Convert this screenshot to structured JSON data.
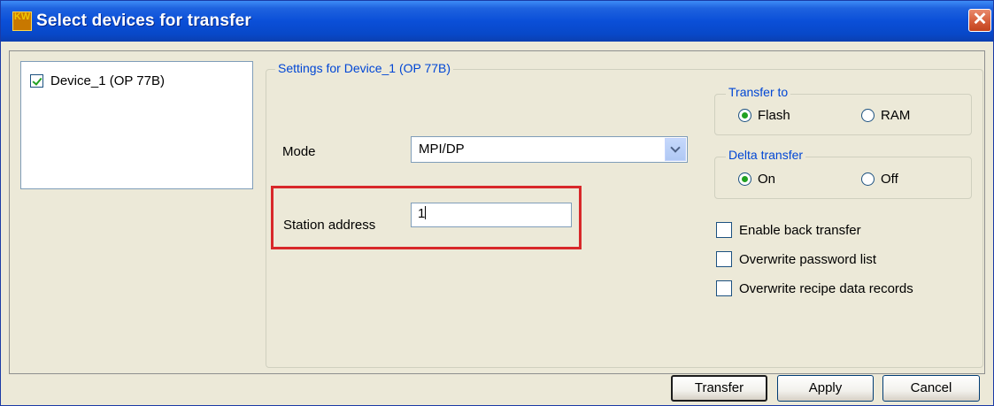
{
  "window": {
    "title": "Select devices for transfer",
    "icon_text": "KW"
  },
  "device_list": {
    "items": [
      {
        "label": "Device_1 (OP 77B)",
        "checked": true
      }
    ]
  },
  "settings": {
    "group_title": "Settings for Device_1 (OP 77B)",
    "mode_label": "Mode",
    "mode_value": "MPI/DP",
    "station_label": "Station address",
    "station_value": "1"
  },
  "transfer_to": {
    "title": "Transfer to",
    "options": [
      "Flash",
      "RAM"
    ],
    "selected": "Flash"
  },
  "delta_transfer": {
    "title": "Delta transfer",
    "options": [
      "On",
      "Off"
    ],
    "selected": "On"
  },
  "checkboxes": [
    {
      "label": "Enable back transfer",
      "checked": false
    },
    {
      "label": "Overwrite password list",
      "checked": false
    },
    {
      "label": "Overwrite recipe data records",
      "checked": false
    }
  ],
  "buttons": {
    "transfer": "Transfer",
    "apply": "Apply",
    "cancel": "Cancel"
  },
  "colors": {
    "titlebar": "#0a4fd8",
    "highlight": "#d8282a",
    "group_title": "#0046d5"
  }
}
